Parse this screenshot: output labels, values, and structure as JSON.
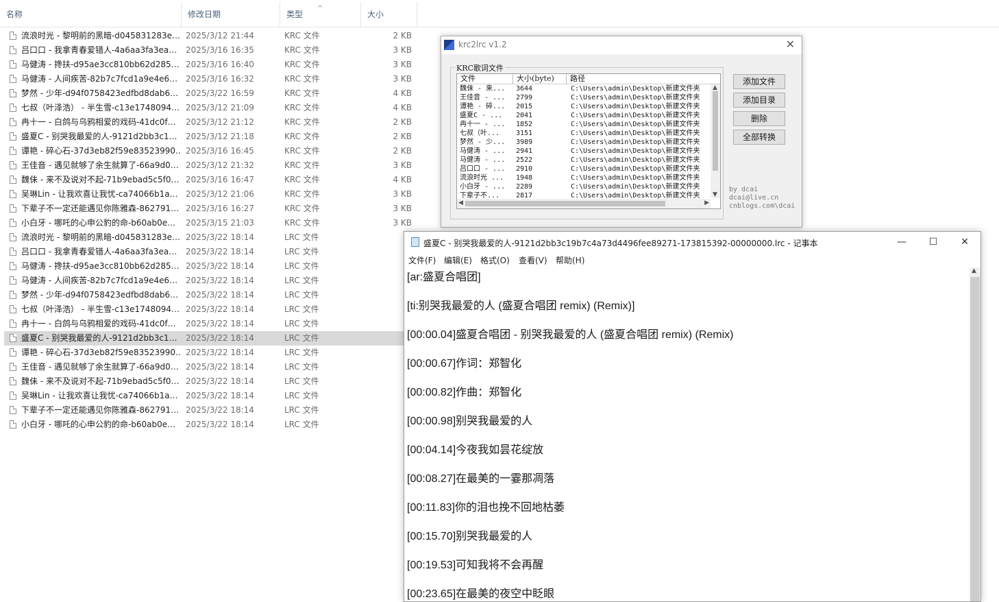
{
  "explorer": {
    "columns": {
      "name": "名称",
      "date": "修改日期",
      "type": "类型",
      "size": "大小"
    },
    "sort_arrow": "^",
    "files": [
      {
        "name": "流浪时光 - 黎明前的黑暗-d045831283e…",
        "date": "2025/3/12 21:44",
        "type": "KRC 文件",
        "size": "2 KB"
      },
      {
        "name": "吕口口 - 我拿青春爱错人-4a6aa3fa3ea…",
        "date": "2025/3/16 16:35",
        "type": "KRC 文件",
        "size": "3 KB"
      },
      {
        "name": "马健涛 - 搀扶-d95ae3cc810bb62d285…",
        "date": "2025/3/16 16:40",
        "type": "KRC 文件",
        "size": "3 KB"
      },
      {
        "name": "马健涛 - 人间疾苦-82b7c7fcd1a9e4e6…",
        "date": "2025/3/16 16:32",
        "type": "KRC 文件",
        "size": "3 KB"
      },
      {
        "name": "梦然 - 少年-d94f0758423edfbd8dab6…",
        "date": "2025/3/22 16:59",
        "type": "KRC 文件",
        "size": "4 KB"
      },
      {
        "name": "七叔（叶泽浩） - 半生雪-c13e1748094…",
        "date": "2025/3/12 21:09",
        "type": "KRC 文件",
        "size": "4 KB"
      },
      {
        "name": "冉十一 - 白鸽与乌鸦相爱的戏码-41dc0f…",
        "date": "2025/3/12 21:12",
        "type": "KRC 文件",
        "size": "2 KB"
      },
      {
        "name": "盛夏C - 别哭我最爱的人-9121d2bb3c1…",
        "date": "2025/3/12 21:18",
        "type": "KRC 文件",
        "size": "2 KB"
      },
      {
        "name": "谭艳 - 碎心石-37d3eb82f59e83523990…",
        "date": "2025/3/16 16:45",
        "type": "KRC 文件",
        "size": "2 KB"
      },
      {
        "name": "王佳音 - 遇见就够了余生就算了-66a9d0…",
        "date": "2025/3/12 21:32",
        "type": "KRC 文件",
        "size": "3 KB"
      },
      {
        "name": "魏佅 - 来不及说对不起-71b9ebad5c5f0…",
        "date": "2025/3/16 16:47",
        "type": "KRC 文件",
        "size": "4 KB"
      },
      {
        "name": "吴琳Lin - 让我欢喜让我忧-ca74066b1a…",
        "date": "2025/3/12 21:06",
        "type": "KRC 文件",
        "size": "3 KB"
      },
      {
        "name": "下辈子不一定还能遇见你陈雅森-862791…",
        "date": "2025/3/16 16:27",
        "type": "KRC 文件",
        "size": "3 KB"
      },
      {
        "name": "小白牙 - 哪吒的心申公豹的命-b60ab0e…",
        "date": "2025/3/15 21:03",
        "type": "KRC 文件",
        "size": "3 KB"
      },
      {
        "name": "流浪时光 - 黎明前的黑暗-d045831283e…",
        "date": "2025/3/22 18:14",
        "type": "LRC 文件",
        "size": "2"
      },
      {
        "name": "吕口口 - 我拿青春爱错人-4a6aa3fa3ea…",
        "date": "2025/3/22 18:14",
        "type": "LRC 文件",
        "size": "2"
      },
      {
        "name": "马健涛 - 搀扶-d95ae3cc810bb62d285…",
        "date": "2025/3/22 18:14",
        "type": "LRC 文件",
        "size": "2"
      },
      {
        "name": "马健涛 - 人间疾苦-82b7c7fcd1a9e4e6…",
        "date": "2025/3/22 18:14",
        "type": "LRC 文件",
        "size": "2"
      },
      {
        "name": "梦然 - 少年-d94f0758423edfbd8dab6…",
        "date": "2025/3/22 18:14",
        "type": "LRC 文件",
        "size": "3"
      },
      {
        "name": "七叔（叶泽浩） - 半生雪-c13e1748094…",
        "date": "2025/3/22 18:14",
        "type": "LRC 文件",
        "size": "2"
      },
      {
        "name": "冉十一 - 白鸽与乌鸦相爱的戏码-41dc0f…",
        "date": "2025/3/22 18:14",
        "type": "LRC 文件",
        "size": "2"
      },
      {
        "name": "盛夏C - 别哭我最爱的人-9121d2bb3c1…",
        "date": "2025/3/22 18:14",
        "type": "LRC 文件",
        "size": "2",
        "selected": true
      },
      {
        "name": "谭艳 - 碎心石-37d3eb82f59e83523990…",
        "date": "2025/3/22 18:14",
        "type": "LRC 文件",
        "size": "2"
      },
      {
        "name": "王佳音 - 遇见就够了余生就算了-66a9d0…",
        "date": "2025/3/22 18:14",
        "type": "LRC 文件",
        "size": "2"
      },
      {
        "name": "魏佅 - 来不及说对不起-71b9ebad5c5f0…",
        "date": "2025/3/22 18:14",
        "type": "LRC 文件",
        "size": "2"
      },
      {
        "name": "吴琳Lin - 让我欢喜让我忧-ca74066b1a…",
        "date": "2025/3/22 18:14",
        "type": "LRC 文件",
        "size": "2"
      },
      {
        "name": "下辈子不一定还能遇见你陈雅森-862791…",
        "date": "2025/3/22 18:14",
        "type": "LRC 文件",
        "size": "2"
      },
      {
        "name": "小白牙 - 哪吒的心申公豹的命-b60ab0e…",
        "date": "2025/3/22 18:14",
        "type": "LRC 文件",
        "size": "2"
      }
    ]
  },
  "krc": {
    "title": "krc2lrc v1.2",
    "close": "✕",
    "group_label": "KRC歌词文件",
    "headers": {
      "file": "文件",
      "size": "大小(byte)",
      "path": "路径"
    },
    "rows": [
      {
        "file": "魏佅 - 来...",
        "size": "3644",
        "path": "C:\\Users\\admin\\Desktop\\新建文件夹"
      },
      {
        "file": "王佳音 - ...",
        "size": "2799",
        "path": "C:\\Users\\admin\\Desktop\\新建文件夹"
      },
      {
        "file": "谭艳 - 碎...",
        "size": "2015",
        "path": "C:\\Users\\admin\\Desktop\\新建文件夹"
      },
      {
        "file": "盛夏C - ...",
        "size": "2041",
        "path": "C:\\Users\\admin\\Desktop\\新建文件夹"
      },
      {
        "file": "冉十一 - ...",
        "size": "1852",
        "path": "C:\\Users\\admin\\Desktop\\新建文件夹"
      },
      {
        "file": "七叔（叶...",
        "size": "3151",
        "path": "C:\\Users\\admin\\Desktop\\新建文件夹"
      },
      {
        "file": "梦然 - 少...",
        "size": "3989",
        "path": "C:\\Users\\admin\\Desktop\\新建文件夹"
      },
      {
        "file": "马健涛 - ...",
        "size": "2941",
        "path": "C:\\Users\\admin\\Desktop\\新建文件夹"
      },
      {
        "file": "马健涛 - ...",
        "size": "2522",
        "path": "C:\\Users\\admin\\Desktop\\新建文件夹"
      },
      {
        "file": "吕口口 - ...",
        "size": "2910",
        "path": "C:\\Users\\admin\\Desktop\\新建文件夹"
      },
      {
        "file": "流浪时光 ...",
        "size": "1948",
        "path": "C:\\Users\\admin\\Desktop\\新建文件夹"
      },
      {
        "file": "小白牙 - ...",
        "size": "2289",
        "path": "C:\\Users\\admin\\Desktop\\新建文件夹"
      },
      {
        "file": "下辈子不...",
        "size": "2817",
        "path": "C:\\Users\\admin\\Desktop\\新建文件夹"
      }
    ],
    "buttons": {
      "add_file": "添加文件",
      "add_dir": "添加目录",
      "delete": "删除",
      "convert_all": "全部转换"
    },
    "credits": [
      "by dcai",
      "dcai@live.cn",
      "cnblogs.com\\dcai"
    ]
  },
  "notepad": {
    "title": "盛夏C - 别哭我最爱的人-9121d2bb3c19b7c4a73d4496fee89271-173815392-00000000.lrc - 记事本",
    "controls": {
      "minimize": "—",
      "maximize": "☐",
      "close": "✕"
    },
    "menu": [
      "文件(F)",
      "编辑(E)",
      "格式(O)",
      "查看(V)",
      "帮助(H)"
    ],
    "lines": [
      "[ar:盛夏合唱团]",
      "[ti:别哭我最爱的人 (盛夏合唱团 remix) (Remix)]",
      "[00:00.04]盛夏合唱团 - 别哭我最爱的人 (盛夏合唱团 remix) (Remix)",
      "[00:00.67]作词：郑智化",
      "[00:00.82]作曲：郑智化",
      "[00:00.98]别哭我最爱的人",
      "[00:04.14]今夜我如昙花绽放",
      "[00:08.27]在最美的一霎那凋落",
      "[00:11.83]你的泪也挽不回地枯萎",
      "[00:15.70]别哭我最爱的人",
      "[00:19.53]可知我将不会再醒",
      "[00:23.65]在最美的夜空中眨眼"
    ]
  }
}
